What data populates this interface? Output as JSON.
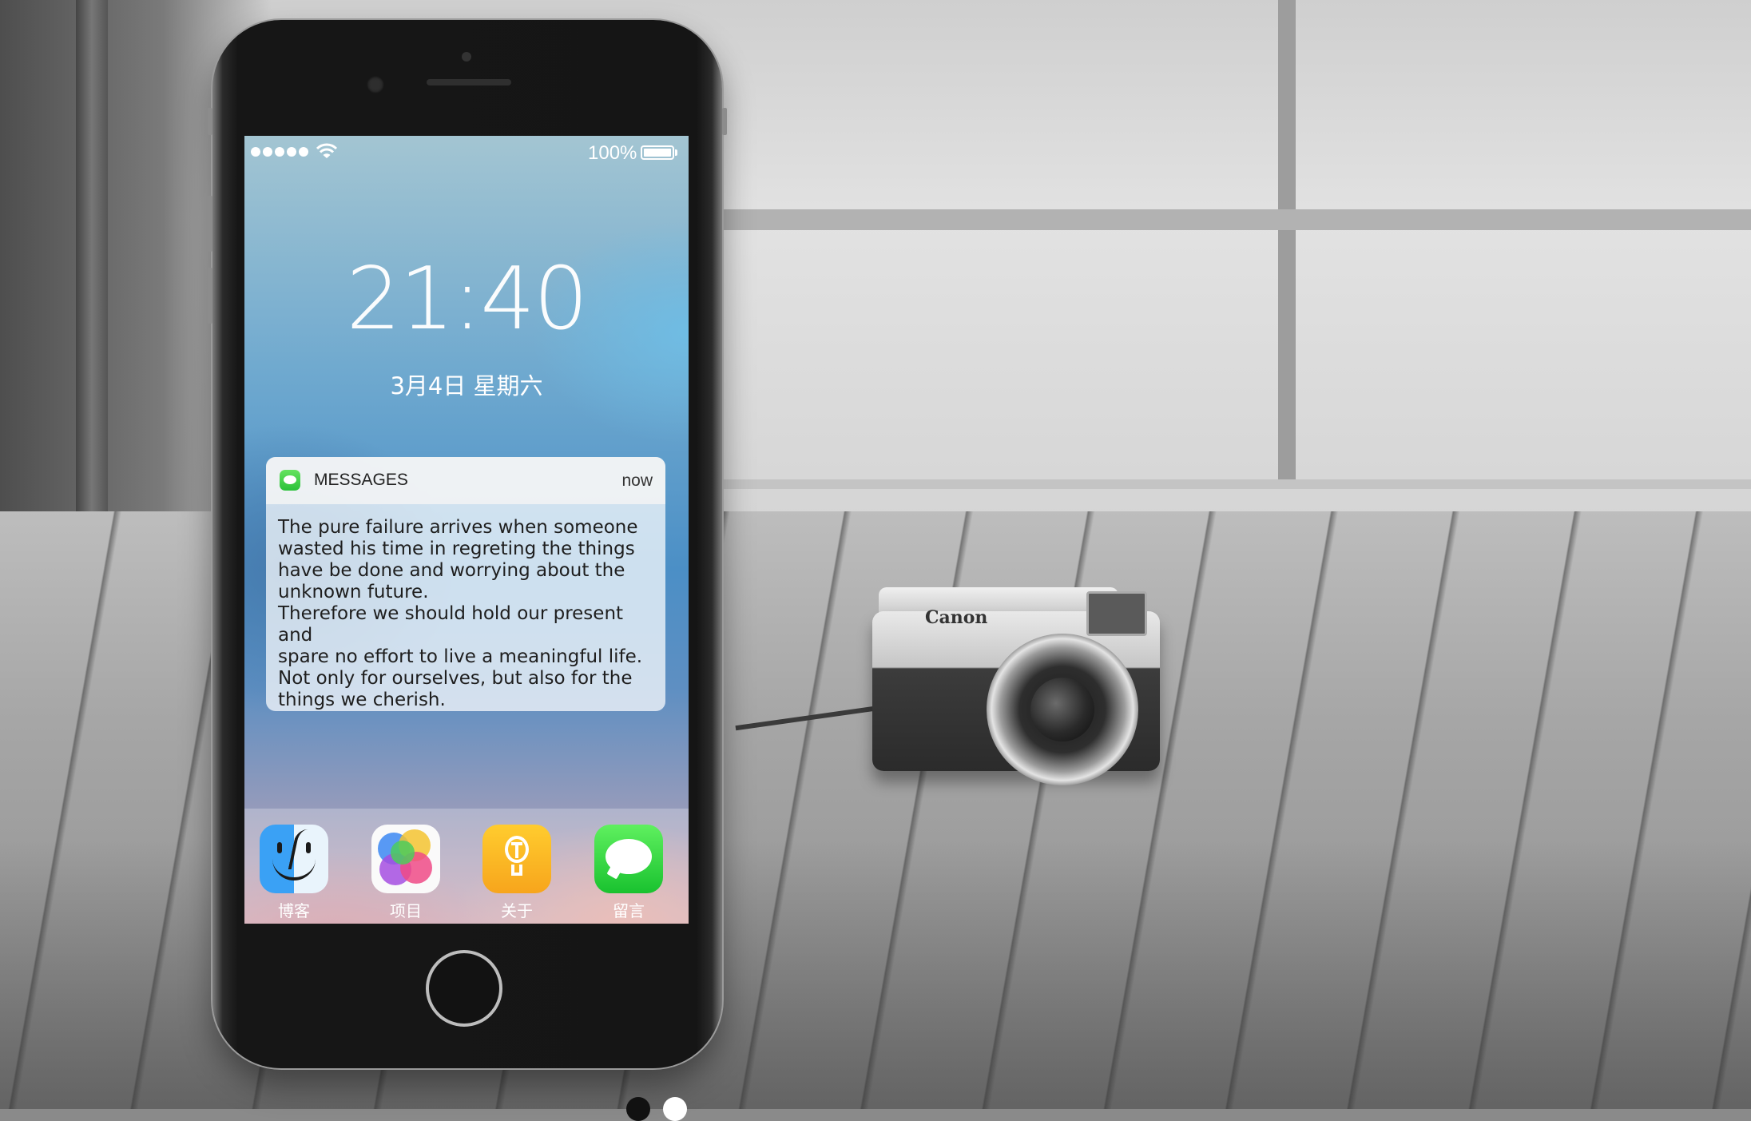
{
  "status_bar": {
    "battery_percent": "100%",
    "signal_bars": 5,
    "wifi": "wifi-icon",
    "battery_icon": "battery-full-icon"
  },
  "lock_screen": {
    "time": "21:40",
    "date": "3月4日 星期六"
  },
  "notification": {
    "app_name": "MESSAGES",
    "time": "now",
    "icon": "messages-app-icon",
    "body_lines": [
      "The pure failure arrives when someone",
      "wasted his time in regreting the things",
      "have be done and worrying about the",
      "unknown future.",
      "Therefore we should hold our present and",
      "spare no effort to live a meaningful life.",
      "Not only for ourselves, but also for the",
      "things we cherish."
    ]
  },
  "dock": {
    "items": [
      {
        "label": "博客",
        "icon": "finder-icon"
      },
      {
        "label": "项目",
        "icon": "game-center-icon"
      },
      {
        "label": "关于",
        "icon": "lightbulb-icon"
      },
      {
        "label": "留言",
        "icon": "messages-icon"
      }
    ]
  },
  "background": {
    "camera_brand": "Canon"
  },
  "pager": {
    "count": 2,
    "active_index": 0
  },
  "colors": {
    "notif_bg": "#f5f5f5",
    "messages_green": "#2bc13a",
    "pager_active": "#111111",
    "pager_inactive": "#ffffff"
  }
}
